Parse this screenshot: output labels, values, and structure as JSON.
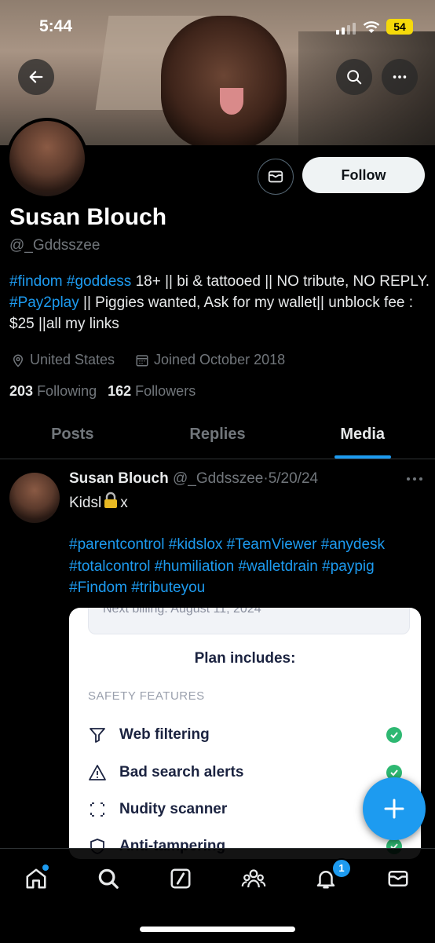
{
  "status": {
    "time": "5:44",
    "battery": "54"
  },
  "profile": {
    "name": "Susan Blouch",
    "handle": "@_Gddsszee",
    "follow_label": "Follow",
    "bio": {
      "tag1": "#findom",
      "tag2": "#goddess",
      "text1": " 18+ || bi & tattooed || NO tribute, NO REPLY. ",
      "tag3": "#Pay2play",
      "text2": " || Piggies wanted, Ask for my wallet|| unblock fee : $25 ||all my links"
    },
    "location": "United States",
    "joined": "Joined October 2018",
    "following_count": "203",
    "following_label": "Following",
    "followers_count": "162",
    "followers_label": "Followers"
  },
  "tabs": [
    {
      "label": "Posts"
    },
    {
      "label": "Replies"
    },
    {
      "label": "Media"
    }
  ],
  "post": {
    "author": "Susan Blouch",
    "handle": "@_Gddsszee",
    "separator": "·",
    "date": "5/20/24",
    "text_before": "Kidsl",
    "text_after": "x",
    "hashtags": "#parentcontrol #kidslox #TeamViewer #anydesk #totalcontrol #humiliation #walletdrain #paypig #Findom #tributeyou"
  },
  "media": {
    "billing": "Next billing: August 11, 2024",
    "plan_title": "Plan includes:",
    "section": "SAFETY FEATURES",
    "features": [
      {
        "label": "Web filtering"
      },
      {
        "label": "Bad search alerts"
      },
      {
        "label": "Nudity scanner"
      },
      {
        "label": "Anti-tampering"
      }
    ]
  },
  "nav": {
    "notifications_badge": "1"
  },
  "colors": {
    "accent": "#1d9bf0",
    "background": "#000000",
    "muted": "#71767b",
    "check": "#2eb872"
  }
}
